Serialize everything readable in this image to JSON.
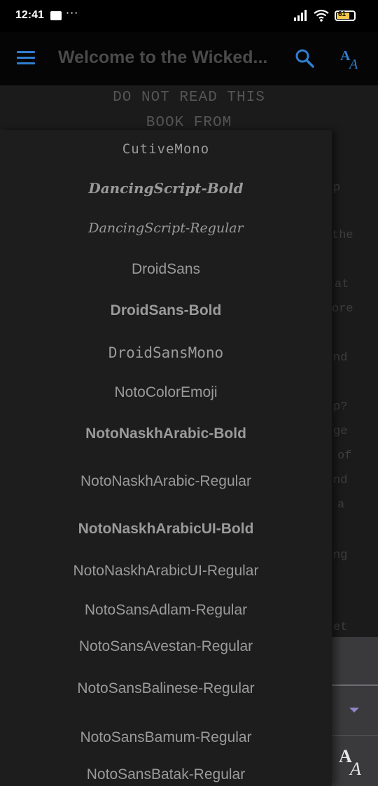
{
  "status_bar": {
    "time": "12:41",
    "dots": "···",
    "battery": "61"
  },
  "app_bar": {
    "title": "Welcome to the Wicked...",
    "accent_color": "#2f7fd1"
  },
  "book": {
    "heading_line1": "DO NOT READ THIS",
    "heading_line2": "BOOK FROM",
    "fragments": [
      "p",
      "the",
      "at",
      "ore",
      "nd",
      "p?",
      "ge",
      "of",
      "nd",
      "a",
      "ng",
      "et"
    ]
  },
  "font_menu": {
    "items": [
      {
        "label": "CutiveMono"
      },
      {
        "label": "DancingScript-Bold"
      },
      {
        "label": "DancingScript-Regular"
      },
      {
        "label": "DroidSans"
      },
      {
        "label": "DroidSans-Bold"
      },
      {
        "label": "DroidSansMono"
      },
      {
        "label": "NotoColorEmoji"
      },
      {
        "label": "NotoNaskhArabic-Bold"
      },
      {
        "label": "NotoNaskhArabic-Regular"
      },
      {
        "label": "NotoNaskhArabicUI-Bold"
      },
      {
        "label": "NotoNaskhArabicUI-Regular"
      },
      {
        "label": "NotoSansAdlam-Regular"
      },
      {
        "label": "NotoSansAvestan-Regular"
      },
      {
        "label": "NotoSansBalinese-Regular"
      },
      {
        "label": "NotoSansBamum-Regular"
      },
      {
        "label": "NotoSansBatak-Regular"
      }
    ]
  },
  "icons": {
    "menu": "menu-icon",
    "search": "search-icon",
    "font_size": "font-size-icon",
    "dropdown": "chevron-down-icon"
  }
}
